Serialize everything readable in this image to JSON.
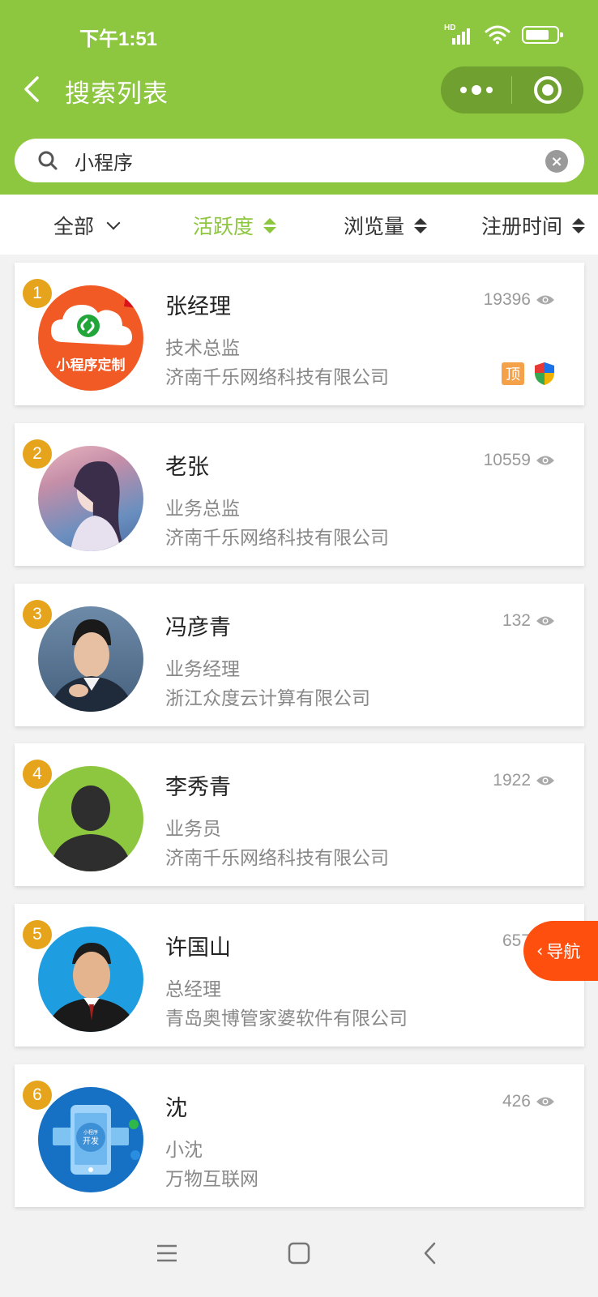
{
  "status_bar": {
    "time": "下午1:51",
    "network": "HD"
  },
  "header": {
    "title": "搜索列表"
  },
  "search": {
    "value": "小程序",
    "placeholder": ""
  },
  "filters": [
    {
      "label": "全部",
      "type": "dropdown",
      "active": false
    },
    {
      "label": "活跃度",
      "type": "sort",
      "active": true
    },
    {
      "label": "浏览量",
      "type": "sort",
      "active": false
    },
    {
      "label": "注册时间",
      "type": "sort",
      "active": false
    }
  ],
  "cards": [
    {
      "rank": "1",
      "name": "张经理",
      "title": "技术总监",
      "company": "济南千乐网络科技有限公司",
      "views": "19396",
      "avatar": "avatar-mini-program-logo",
      "badge_top": "顶",
      "badge_shield": true,
      "avatar_text": "小程序定制"
    },
    {
      "rank": "2",
      "name": "老张",
      "title": "业务总监",
      "company": "济南千乐网络科技有限公司",
      "views": "10559",
      "avatar": "avatar-photo-woman"
    },
    {
      "rank": "3",
      "name": "冯彦青",
      "title": "业务经理",
      "company": "浙江众度云计算有限公司",
      "views": "132",
      "avatar": "avatar-photo-man-suit"
    },
    {
      "rank": "4",
      "name": "李秀青",
      "title": "业务员",
      "company": "济南千乐网络科技有限公司",
      "views": "1922",
      "avatar": "avatar-default-silhouette"
    },
    {
      "rank": "5",
      "name": "许国山",
      "title": "总经理",
      "company": "青岛奥博管家婆软件有限公司",
      "views": "657",
      "avatar": "avatar-photo-man-blue"
    },
    {
      "rank": "6",
      "name": "沈",
      "title": "小沈",
      "company": "万物互联网",
      "views": "426",
      "avatar": "avatar-app-dev",
      "avatar_text_1": "小程序",
      "avatar_text_2": "开发"
    }
  ],
  "float_nav": {
    "label": "导航"
  },
  "colors": {
    "brand_green": "#8dc63f",
    "rank_orange": "#e5a41b",
    "nav_orange": "#ff4f0f"
  }
}
